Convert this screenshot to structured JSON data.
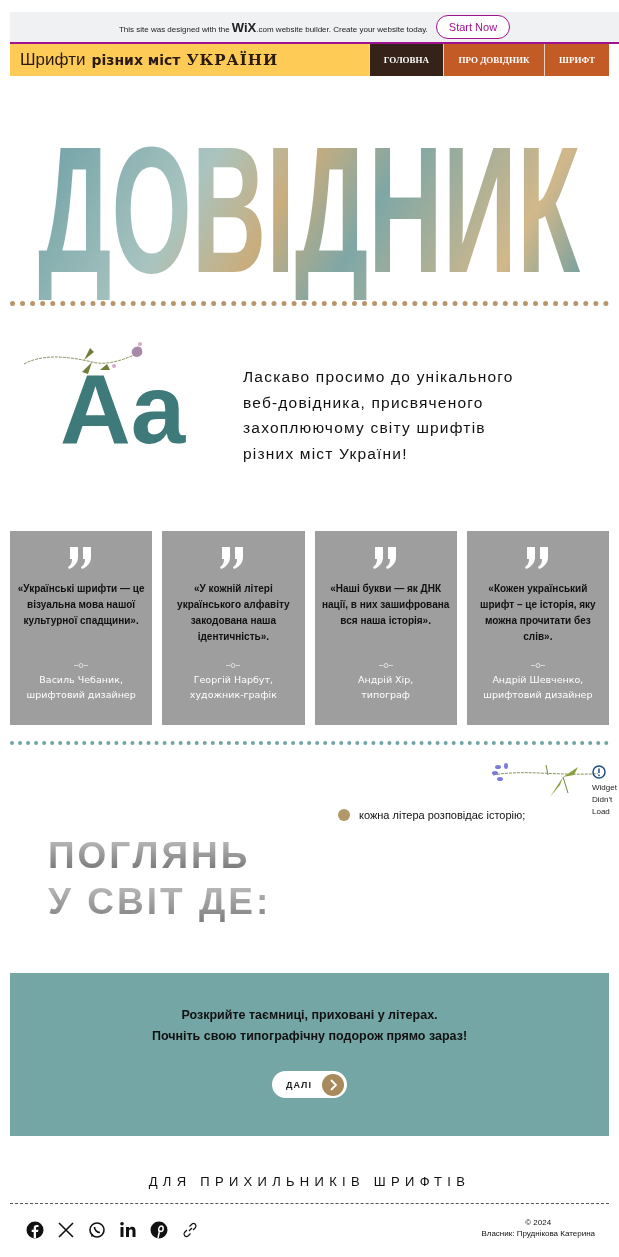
{
  "banner": {
    "text_before": "This site was designed with the",
    "brand": "WiX",
    "text_after": ".com website builder. Create your website today.",
    "button": "Start Now"
  },
  "header": {
    "logo_parts": [
      "Шрифти",
      "різних міст",
      "УКРАЇНИ"
    ],
    "nav": [
      {
        "label": "ГОЛОВНА",
        "selected": true
      },
      {
        "label": "ПРО ДОВІДНИК",
        "selected": false
      },
      {
        "label": "ШРИФТ",
        "selected": false
      }
    ]
  },
  "hero": {
    "title": "ДОВІДНИК"
  },
  "welcome": {
    "letters": "Aa",
    "text": "Ласкаво просимо до унікального веб-довідника, присвяченого захоплюючому світу шрифтів різних міст України!"
  },
  "quotes": [
    {
      "text": "«Українські шрифти — це візуальна мова нашої культурної спадщини».",
      "author": "Василь Чебаник,",
      "role": "шрифтовий дизайнер"
    },
    {
      "text": "«У кожній літері українського алфавіту закодована наша ідентичність».",
      "author": "Георгій Нарбут,",
      "role": "художник-графік"
    },
    {
      "text": "«Наші букви — як ДНК нації, в них зашифрована вся наша історія».",
      "author": "Андрій Хір,",
      "role": "типограф"
    },
    {
      "text": "«Кожен український шрифт – це історія, яку можна прочитати без слів».",
      "author": "Андрій Шевченко,",
      "role": "шрифтовий дизайнер"
    }
  ],
  "widget_error": {
    "lines": [
      "Widget",
      "Didn't",
      "Load"
    ]
  },
  "bullet": {
    "text": "кожна літера розповідає історію;",
    "color": "#b09868"
  },
  "look": {
    "lines": [
      "ПОГЛЯНЬ",
      "У СВІТ ДЕ:"
    ]
  },
  "cta": {
    "lines": [
      "Розкрийте таємниці, приховані у літерах.",
      "Почніть свою типографічну подорож прямо зараз!"
    ],
    "button": "ДАЛІ"
  },
  "footer": {
    "title": "ДЛЯ ПРИХИЛЬНИКІВ ШРИФТІВ",
    "copyright": "© 2024",
    "owner": "Власник: Пруднікова Катерина"
  }
}
